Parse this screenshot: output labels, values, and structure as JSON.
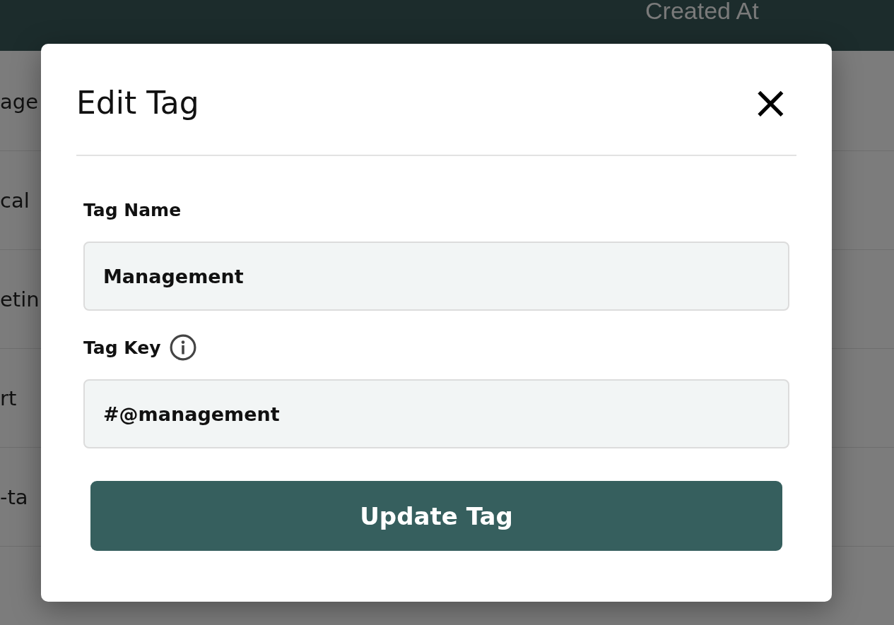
{
  "table": {
    "header": "Created At",
    "rows": [
      "age",
      "cal",
      "etin",
      "rt",
      "-ta"
    ]
  },
  "dialog": {
    "title": "Edit Tag",
    "close": "×",
    "fields": [
      {
        "label": "Tag Name",
        "info": false,
        "value": "Management"
      },
      {
        "label": "Tag Key",
        "info": true,
        "value": "#@management"
      }
    ],
    "button": "Update Tag"
  }
}
